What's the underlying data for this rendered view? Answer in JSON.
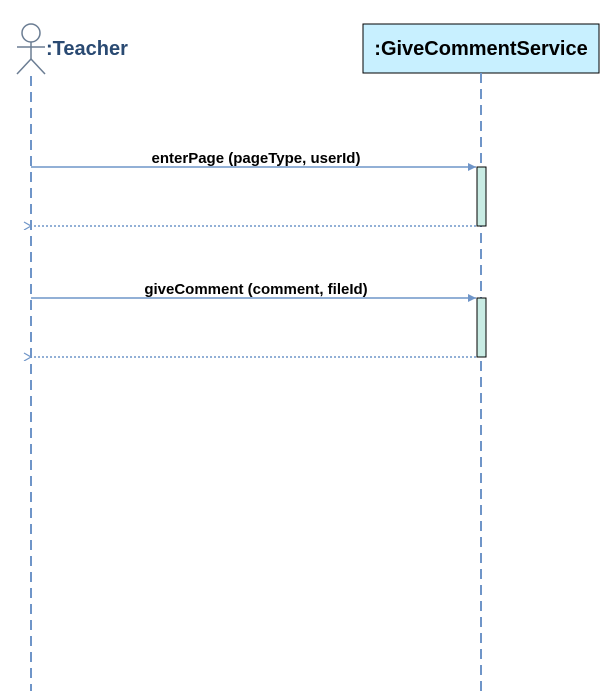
{
  "participants": {
    "teacher": {
      "label": ":Teacher",
      "kind": "actor"
    },
    "service": {
      "label": ":GiveCommentService",
      "kind": "object"
    }
  },
  "messages": [
    {
      "label": "enterPage (pageType, userId)",
      "type": "synchronous-call",
      "from": "teacher",
      "to": "service"
    },
    {
      "label": "",
      "type": "return",
      "from": "service",
      "to": "teacher"
    },
    {
      "label": "giveComment (comment, fileId)",
      "type": "synchronous-call",
      "from": "teacher",
      "to": "service"
    },
    {
      "label": "",
      "type": "return",
      "from": "service",
      "to": "teacher"
    }
  ],
  "colors": {
    "line": "#6f95c8",
    "actor_stroke": "#6b7d93",
    "actor_text": "#2a4a72",
    "service_fill": "#c8f0ff",
    "service_stroke": "#000000",
    "activation_fill": "#c9ece4",
    "activation_stroke": "#000000"
  }
}
